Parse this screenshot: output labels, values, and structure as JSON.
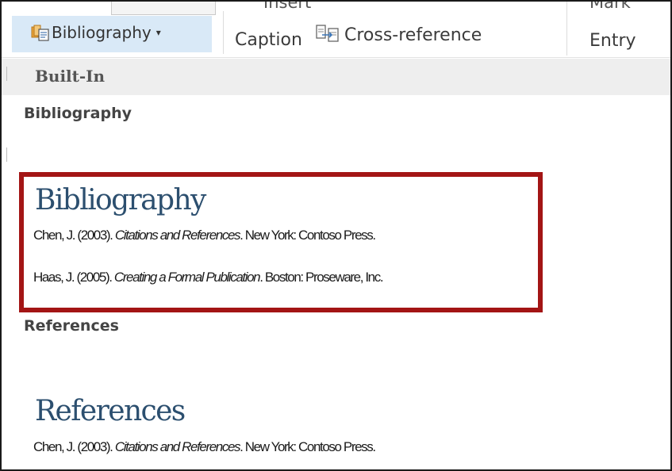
{
  "ribbon": {
    "bibliography_button": "Bibliography",
    "insert_label": "Insert",
    "caption_label": "Caption",
    "cross_reference_label": "Cross-reference",
    "mark_label": "Mark",
    "entry_label": "Entry"
  },
  "gallery": {
    "section_header": "Built-In",
    "items": [
      {
        "label": "Bibliography",
        "preview_title": "Bibliography",
        "entries": [
          {
            "authors": "Chen, J. (2003). ",
            "title": "Citations and References",
            "rest": ". New York: Contoso Press."
          },
          {
            "authors": "Haas, J. (2005). ",
            "title": "Creating a Formal Publication",
            "rest": ". Boston: Proseware, Inc."
          }
        ]
      },
      {
        "label": "References",
        "preview_title": "References",
        "entries": [
          {
            "authors": "Chen, J. (2003). ",
            "title": "Citations and References",
            "rest": ". New York: Contoso Press."
          }
        ]
      }
    ]
  },
  "colors": {
    "highlight_border": "#a31515",
    "selected_button_bg": "#d9e9f7",
    "preview_heading": "#2c4f6f"
  },
  "icons": [
    "bibliography-icon",
    "dropdown-caret-icon",
    "cross-reference-icon"
  ]
}
